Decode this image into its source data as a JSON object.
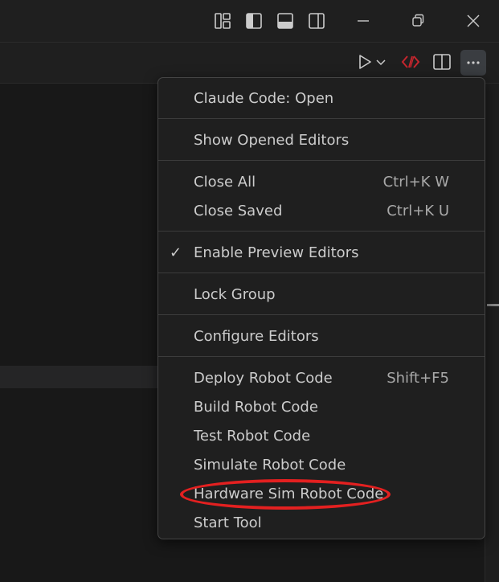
{
  "menu": {
    "items": [
      {
        "label": "Claude Code: Open"
      },
      {
        "label": "Show Opened Editors"
      },
      {
        "label": "Close All",
        "shortcut": "Ctrl+K W"
      },
      {
        "label": "Close Saved",
        "shortcut": "Ctrl+K U"
      },
      {
        "label": "Enable Preview Editors",
        "checked": true,
        "check_glyph": "✓"
      },
      {
        "label": "Lock Group"
      },
      {
        "label": "Configure Editors"
      },
      {
        "label": "Deploy Robot Code",
        "shortcut": "Shift+F5"
      },
      {
        "label": "Build Robot Code"
      },
      {
        "label": "Test Robot Code"
      },
      {
        "label": "Simulate Robot Code"
      },
      {
        "label": "Hardware Sim Robot Code",
        "highlighted": true
      },
      {
        "label": "Start Tool"
      }
    ]
  },
  "titlebar": {
    "icons": [
      "customize-layout-icon",
      "toggle-primary-sidebar-icon",
      "toggle-panel-icon",
      "toggle-secondary-sidebar-icon",
      "minimize-icon",
      "restore-icon",
      "close-icon"
    ]
  },
  "toolbar": {
    "icons": [
      "run-icon",
      "run-dropdown-chevron-icon",
      "wpilib-icon",
      "split-editor-icon",
      "more-actions-icon"
    ]
  },
  "colors": {
    "background": "#181818",
    "menu_background": "#1f1f1f",
    "highlight_circle": "#e32020",
    "wpilib_red": "#c4262e"
  }
}
